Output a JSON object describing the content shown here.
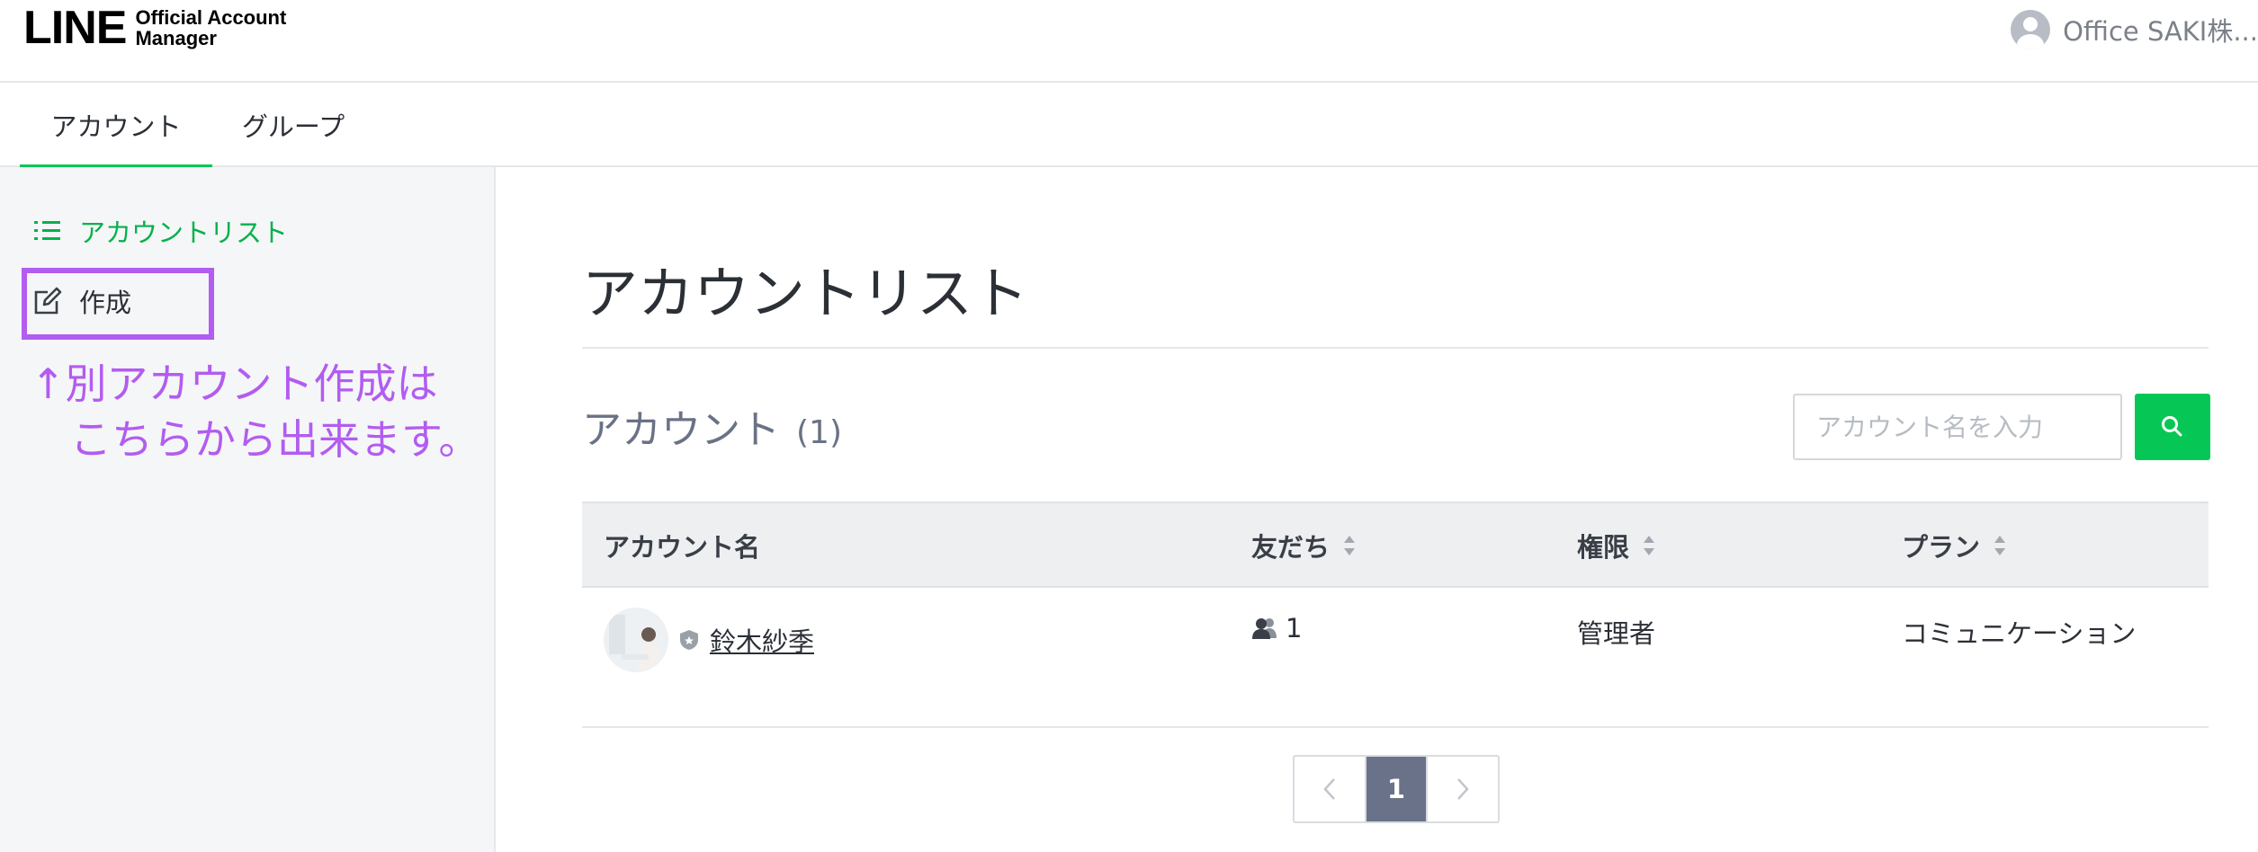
{
  "header": {
    "logo_main": "LINE",
    "logo_sub_1": "Official Account",
    "logo_sub_2": "Manager",
    "user_name": "Office SAKI株..."
  },
  "tabs": [
    {
      "label": "アカウント",
      "active": true
    },
    {
      "label": "グループ",
      "active": false
    }
  ],
  "sidebar": {
    "items": [
      {
        "label": "アカウントリスト",
        "icon": "list-icon",
        "active": true
      },
      {
        "label": "作成",
        "icon": "edit-icon",
        "active": false
      }
    ],
    "annotation_line1": "↑別アカウント作成は",
    "annotation_line2": "こちらから出来ます。"
  },
  "main": {
    "page_title": "アカウントリスト",
    "section_title": "アカウント",
    "section_count": "(1)",
    "search": {
      "placeholder": "アカウント名を入力",
      "value": ""
    },
    "table": {
      "headers": [
        "アカウント名",
        "友だち",
        "権限",
        "プラン"
      ],
      "rows": [
        {
          "name": "鈴木紗季",
          "friends": "1",
          "role": "管理者",
          "plan": "コミュニケーション"
        }
      ]
    },
    "pagination": {
      "current": "1"
    }
  },
  "colors": {
    "brand_green": "#06c755",
    "annotation_purple": "#b25cf1",
    "pager_active": "#6a7289"
  }
}
